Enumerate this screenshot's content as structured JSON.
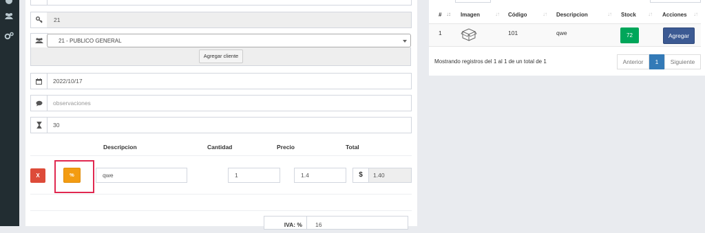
{
  "sidebar": {
    "icons": [
      "circle-icon",
      "users-icon",
      "gears-icon"
    ]
  },
  "form": {
    "key_field": {
      "icon": "key-icon",
      "value": "21"
    },
    "client_select": {
      "icon": "users-icon",
      "selected": "21 - PUBLICO GENERAL"
    },
    "add_client_button": "Agregar cliente",
    "date_field": {
      "icon": "calendar-icon",
      "value": "2022/10/17"
    },
    "observations_field": {
      "icon": "comment-icon",
      "placeholder": "observaciones"
    },
    "term_field": {
      "icon": "hourglass-icon",
      "value": "30"
    }
  },
  "items_table": {
    "headers": {
      "descripcion": "Descripcion",
      "cantidad": "Cantidad",
      "precio": "Precio",
      "total": "Total"
    },
    "row": {
      "remove_label": "X",
      "discount_label": "%",
      "descripcion": "qwe",
      "cantidad": "1",
      "precio": "1.4",
      "currency": "$",
      "total": "1.40"
    }
  },
  "iva": {
    "label": "IVA: %",
    "value": "16"
  },
  "products_table": {
    "headers": {
      "num": "#",
      "imagen": "Imagen",
      "codigo": "Código",
      "descripcion": "Descripcion",
      "stock": "Stock",
      "acciones": "Acciones"
    },
    "rows": [
      {
        "num": "1",
        "image_icon": "box-icon",
        "codigo": "101",
        "descripcion": "qwe",
        "stock": "72",
        "action": "Agregar"
      }
    ],
    "info": "Mostrando registros del 1 al 1 de un total de 1",
    "pagination": {
      "prev": "Anterior",
      "page": "1",
      "next": "Siguiente"
    }
  },
  "colors": {
    "danger": "#dd4b39",
    "warning": "#f39c12",
    "success": "#00a65a",
    "primary": "#3c5a93",
    "highlight": "#e0274f"
  }
}
